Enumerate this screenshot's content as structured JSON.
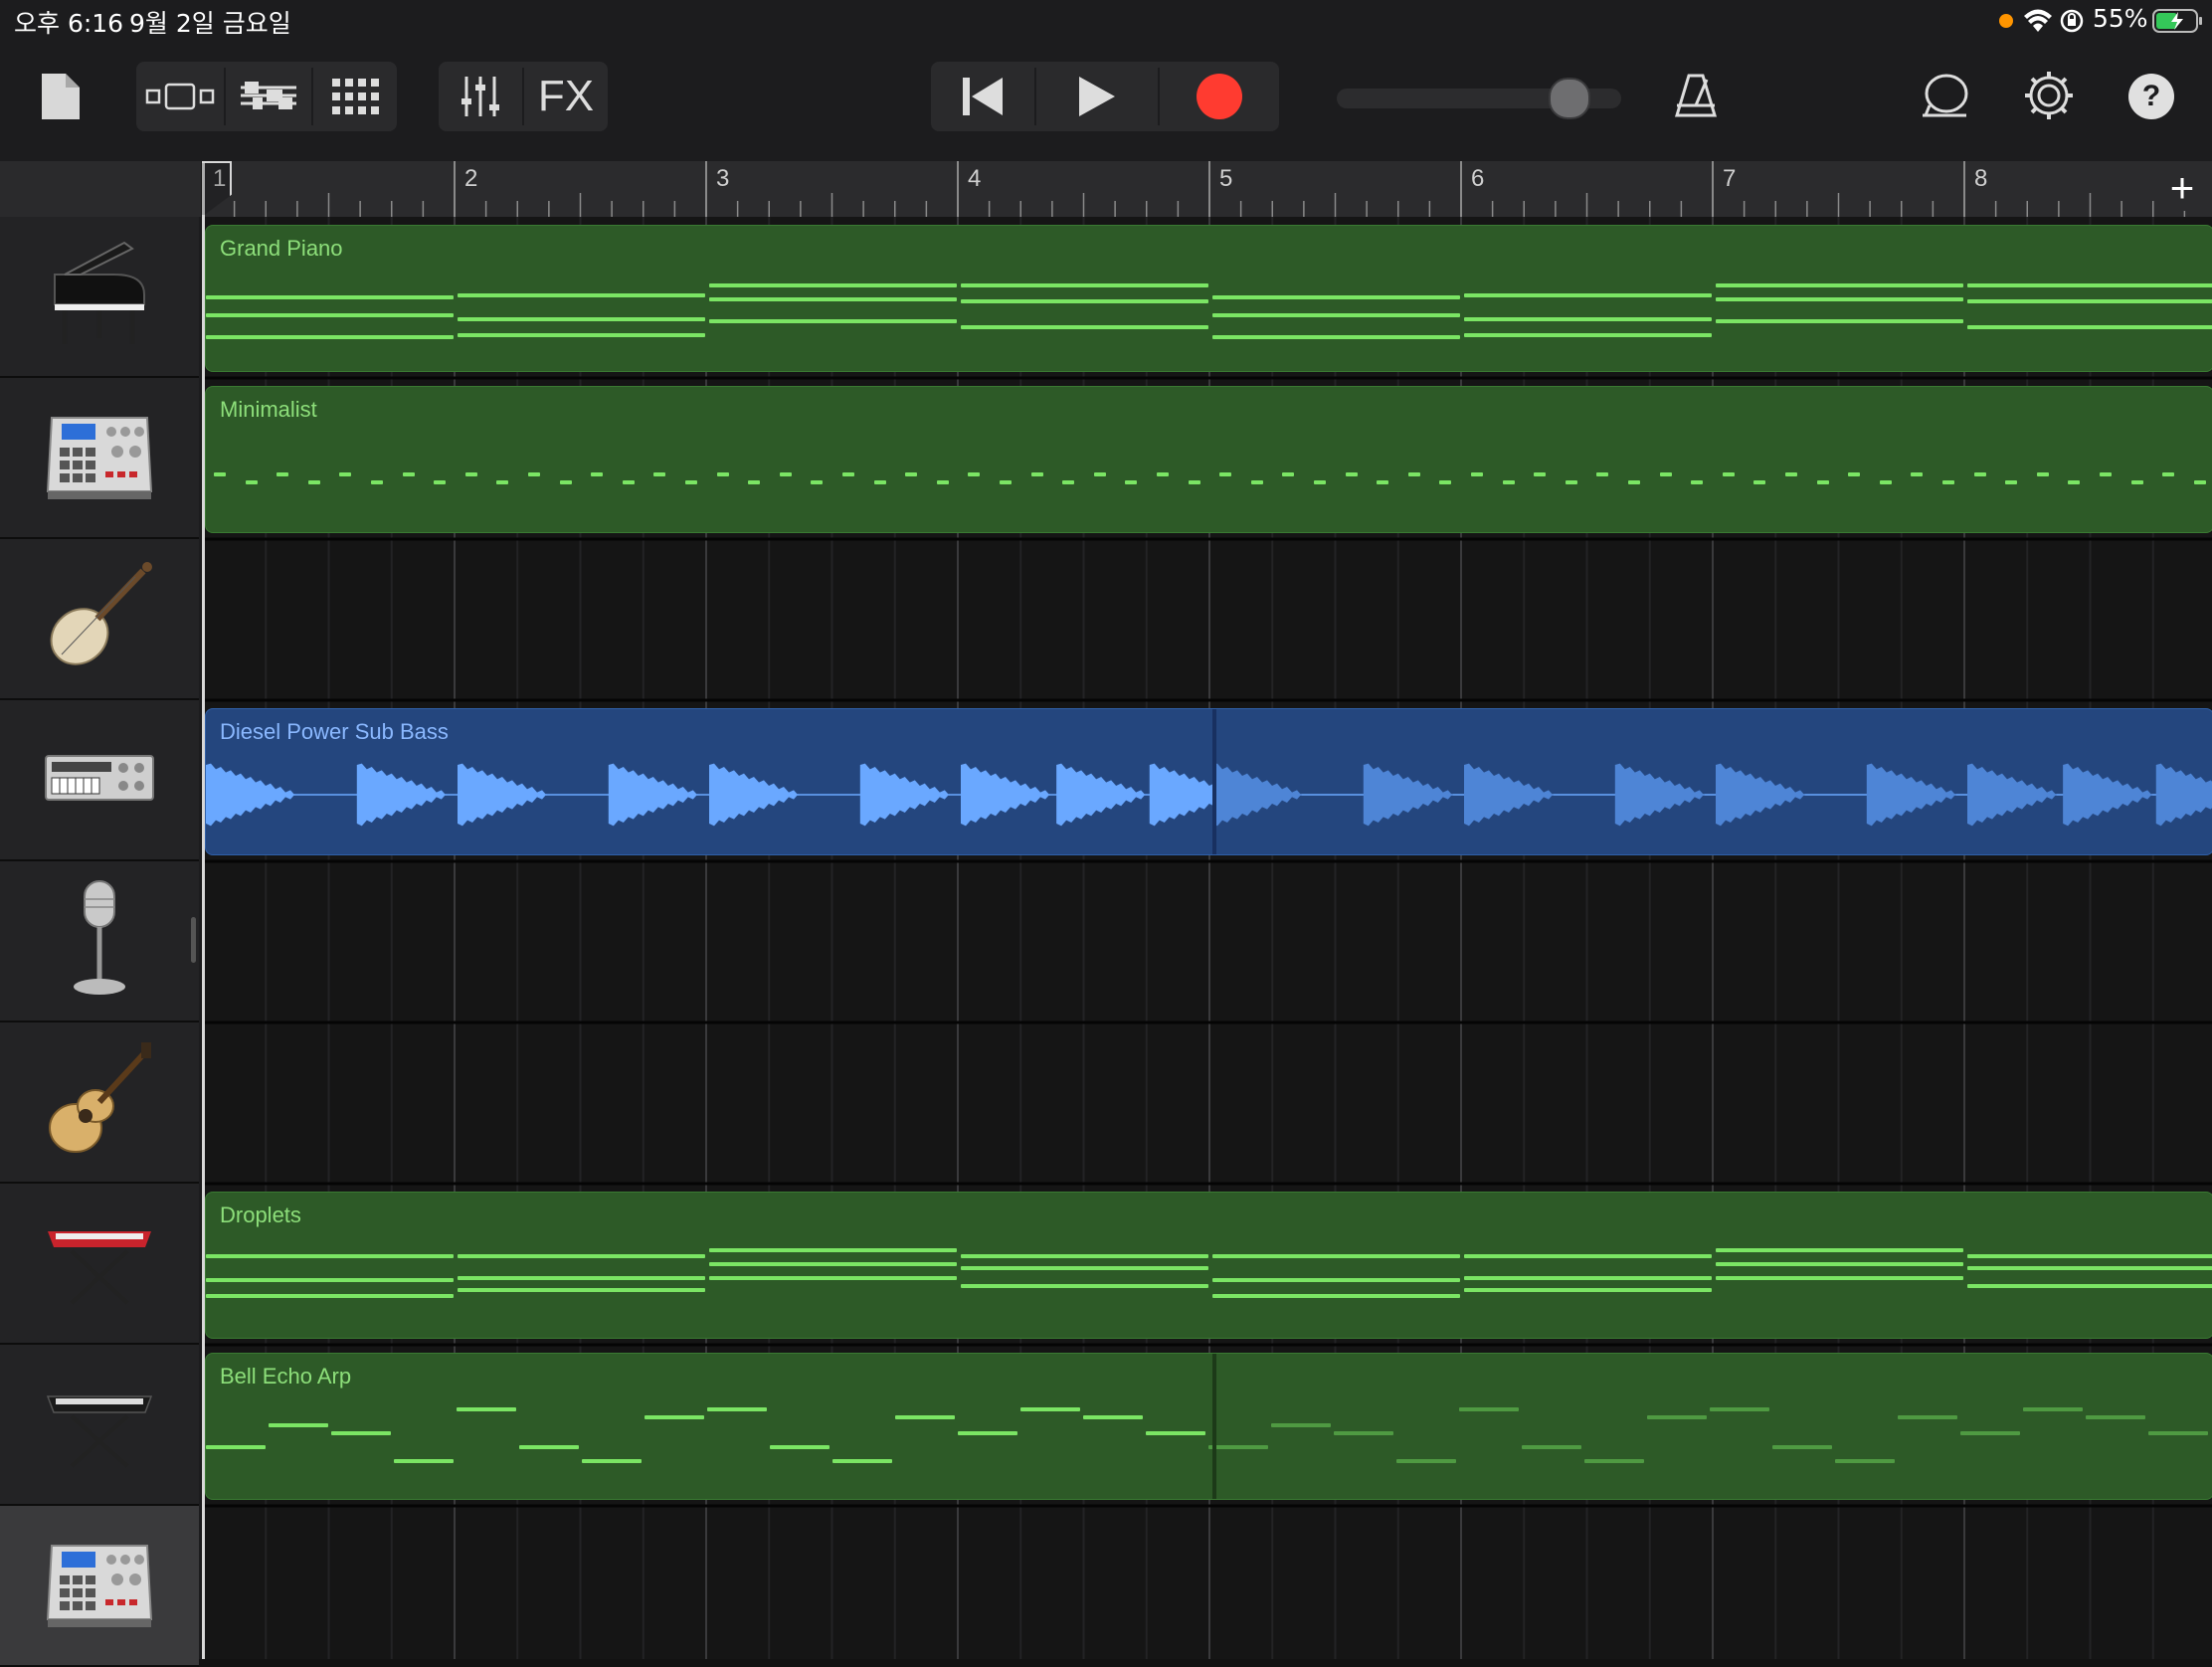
{
  "status": {
    "time": "오후 6:16",
    "date": "9월 2일 금요일",
    "battery": "55%",
    "battery_level": 0.55
  },
  "toolbar": {
    "icons": [
      "document-icon",
      "track-view-icon",
      "loop-browser-icon",
      "grid-icon",
      "mixer-icon",
      "fx-label",
      "rewind-icon",
      "play-icon",
      "record-icon",
      "master-volume-slider",
      "metronome-icon",
      "chat-icon",
      "settings-icon",
      "help-icon"
    ],
    "fx_label": "FX",
    "help_label": "?",
    "volume_level": 0.81,
    "record_color": "#ff3b30"
  },
  "ruler": {
    "bars": [
      "1",
      "2",
      "3",
      "4",
      "5",
      "6",
      "7",
      "8"
    ],
    "add_label": "+"
  },
  "tracks": [
    {
      "instrument": "grand-piano",
      "region": "Grand Piano",
      "type": "midi"
    },
    {
      "instrument": "drum-machine",
      "region": "Minimalist",
      "type": "midi"
    },
    {
      "instrument": "pipa",
      "region": "",
      "type": "empty"
    },
    {
      "instrument": "bass-synth",
      "region": "Diesel Power Sub Bass",
      "type": "audio"
    },
    {
      "instrument": "microphone",
      "region": "",
      "type": "empty"
    },
    {
      "instrument": "acoustic-guitar",
      "region": "",
      "type": "empty"
    },
    {
      "instrument": "red-keyboard",
      "region": "Droplets",
      "type": "midi"
    },
    {
      "instrument": "black-keyboard",
      "region": "Bell Echo Arp",
      "type": "midi"
    },
    {
      "instrument": "drum-machine",
      "region": "",
      "type": "empty"
    }
  ],
  "colors": {
    "midi_region": "#2d5a27",
    "midi_note": "#7be564",
    "audio_region": "#24467e",
    "audio_wave": "#6aa8ff"
  }
}
